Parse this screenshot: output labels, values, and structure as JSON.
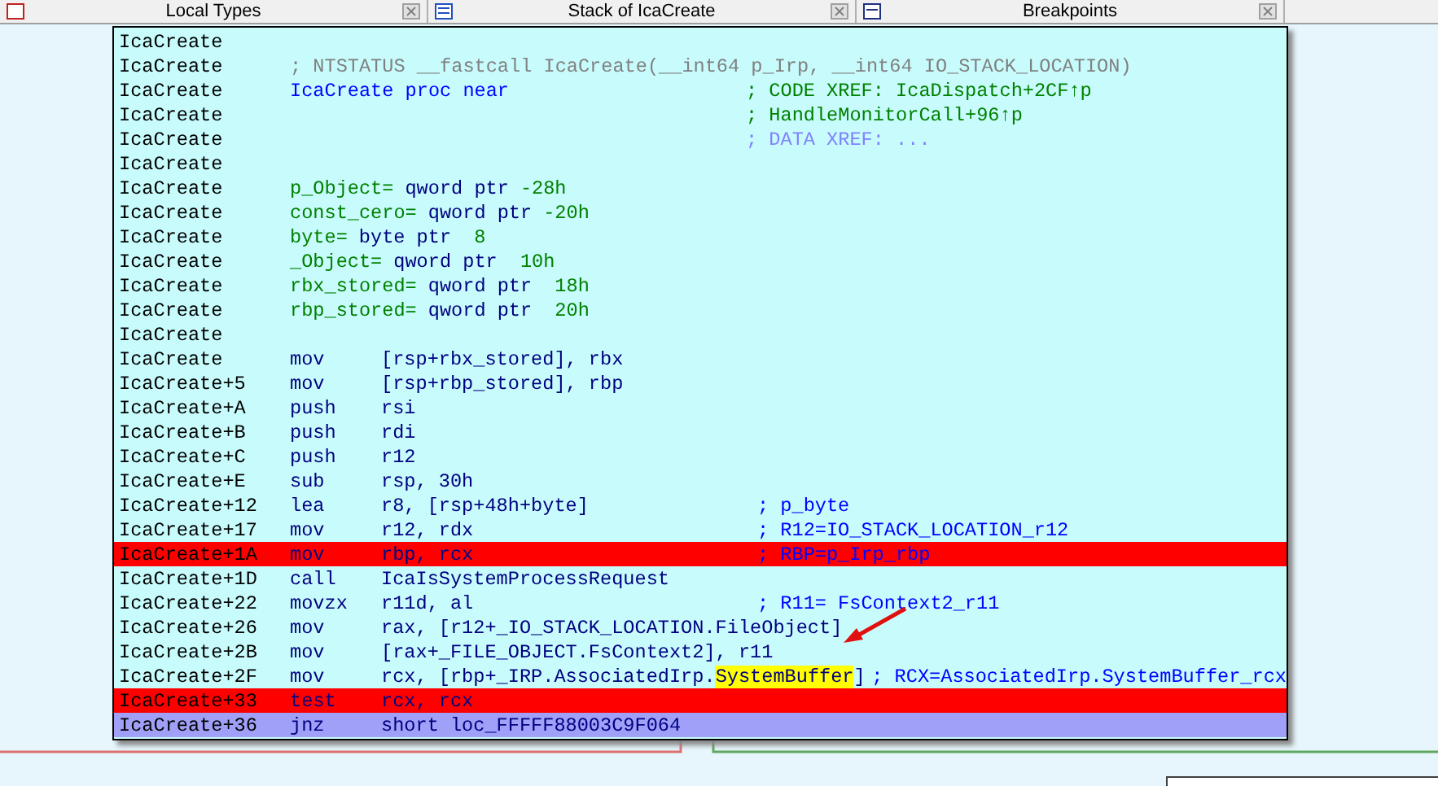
{
  "tabs": [
    {
      "label": "Local Types",
      "selected": false
    },
    {
      "label": "Stack of IcaCreate",
      "selected": false
    },
    {
      "label": "Breakpoints",
      "selected": false
    }
  ],
  "graph_node": {
    "rows": [
      {
        "kind": "blank",
        "address": "IcaCreate",
        "breakpoint": false,
        "current": false
      },
      {
        "kind": "note",
        "address": "IcaCreate",
        "text": "; NTSTATUS __fastcall IcaCreate(__int64 p_Irp, __int64 IO_STACK_LOCATION)",
        "breakpoint": false,
        "current": false
      },
      {
        "kind": "proc",
        "address": "IcaCreate",
        "text": "IcaCreate proc near",
        "comment": "; CODE XREF: IcaDispatch+2CF↑p",
        "breakpoint": false,
        "current": false
      },
      {
        "kind": "xref",
        "address": "IcaCreate",
        "comment": "; HandleMonitorCall+96↑p",
        "breakpoint": false,
        "current": false
      },
      {
        "kind": "data_xref",
        "address": "IcaCreate",
        "comment": "; DATA XREF: ...",
        "breakpoint": false,
        "current": false
      },
      {
        "kind": "blank",
        "address": "IcaCreate",
        "breakpoint": false,
        "current": false
      },
      {
        "kind": "var",
        "address": "IcaCreate",
        "name": "p_Object=",
        "type": "qword ptr",
        "value": "-28h",
        "breakpoint": false,
        "current": false
      },
      {
        "kind": "var",
        "address": "IcaCreate",
        "name": "const_cero=",
        "type": "qword ptr",
        "value": "-20h",
        "breakpoint": false,
        "current": false
      },
      {
        "kind": "var",
        "address": "IcaCreate",
        "name": "byte=",
        "type": "byte ptr",
        "value": " 8",
        "breakpoint": false,
        "current": false
      },
      {
        "kind": "var",
        "address": "IcaCreate",
        "name": "_Object=",
        "type": "qword ptr",
        "value": " 10h",
        "breakpoint": false,
        "current": false
      },
      {
        "kind": "var",
        "address": "IcaCreate",
        "name": "rbx_stored=",
        "type": "qword ptr",
        "value": " 18h",
        "breakpoint": false,
        "current": false
      },
      {
        "kind": "var",
        "address": "IcaCreate",
        "name": "rbp_stored=",
        "type": "qword ptr",
        "value": " 20h",
        "breakpoint": false,
        "current": false
      },
      {
        "kind": "blank",
        "address": "IcaCreate",
        "breakpoint": false,
        "current": false
      },
      {
        "kind": "insn",
        "address": "IcaCreate",
        "mnemonic": "mov",
        "operand": "[rsp+rbx_stored], rbx",
        "breakpoint": false,
        "current": false
      },
      {
        "kind": "insn",
        "address": "IcaCreate+5",
        "mnemonic": "mov",
        "operand": "[rsp+rbp_stored], rbp",
        "breakpoint": false,
        "current": false
      },
      {
        "kind": "insn",
        "address": "IcaCreate+A",
        "mnemonic": "push",
        "operand": "rsi",
        "breakpoint": false,
        "current": false
      },
      {
        "kind": "insn",
        "address": "IcaCreate+B",
        "mnemonic": "push",
        "operand": "rdi",
        "breakpoint": false,
        "current": false
      },
      {
        "kind": "insn",
        "address": "IcaCreate+C",
        "mnemonic": "push",
        "operand": "r12",
        "breakpoint": false,
        "current": false
      },
      {
        "kind": "insn",
        "address": "IcaCreate+E",
        "mnemonic": "sub",
        "operand": "rsp, 30h",
        "breakpoint": false,
        "current": false
      },
      {
        "kind": "insn",
        "address": "IcaCreate+12",
        "mnemonic": "lea",
        "operand": "r8, [rsp+48h+byte]",
        "comment": "; p_byte",
        "breakpoint": false,
        "current": false
      },
      {
        "kind": "insn",
        "address": "IcaCreate+17",
        "mnemonic": "mov",
        "operand": "r12, rdx",
        "comment": "; R12=IO_STACK_LOCATION_r12",
        "breakpoint": false,
        "current": false
      },
      {
        "kind": "insn",
        "address": "IcaCreate+1A",
        "mnemonic": "mov",
        "operand": "rbp, rcx",
        "comment": "; RBP=p_Irp_rbp",
        "breakpoint": true,
        "current": false
      },
      {
        "kind": "insn",
        "address": "IcaCreate+1D",
        "mnemonic": "call",
        "operand": "IcaIsSystemProcessRequest",
        "breakpoint": false,
        "current": false
      },
      {
        "kind": "insn",
        "address": "IcaCreate+22",
        "mnemonic": "movzx",
        "operand": "r11d, al",
        "comment": "; R11= FsContext2_r11",
        "breakpoint": false,
        "current": false
      },
      {
        "kind": "insn",
        "address": "IcaCreate+26",
        "mnemonic": "mov",
        "operand": "rax, [r12+_IO_STACK_LOCATION.FileObject]",
        "breakpoint": false,
        "current": false
      },
      {
        "kind": "insn",
        "address": "IcaCreate+2B",
        "mnemonic": "mov",
        "operand": "[rax+_FILE_OBJECT.FsContext2], r11",
        "breakpoint": false,
        "current": false
      },
      {
        "kind": "insn",
        "address": "IcaCreate+2F",
        "mnemonic": "mov",
        "operand": [
          {
            "text": "rcx, [rbp+_IRP.AssociatedIrp.",
            "highlighted": false
          },
          {
            "text": "SystemBuffer",
            "highlighted": true
          },
          {
            "text": "]",
            "highlighted": false
          }
        ],
        "comment": "; RCX=AssociatedIrp.SystemBuffer_rcx",
        "breakpoint": false,
        "current": false
      },
      {
        "kind": "insn",
        "address": "IcaCreate+33",
        "mnemonic": "test",
        "operand": "rcx, rcx",
        "breakpoint": true,
        "current": false
      },
      {
        "kind": "insn",
        "address": "IcaCreate+36",
        "mnemonic": "jnz",
        "operand": "short loc_FFFFF88003C9F064",
        "breakpoint": false,
        "current": true
      }
    ]
  }
}
